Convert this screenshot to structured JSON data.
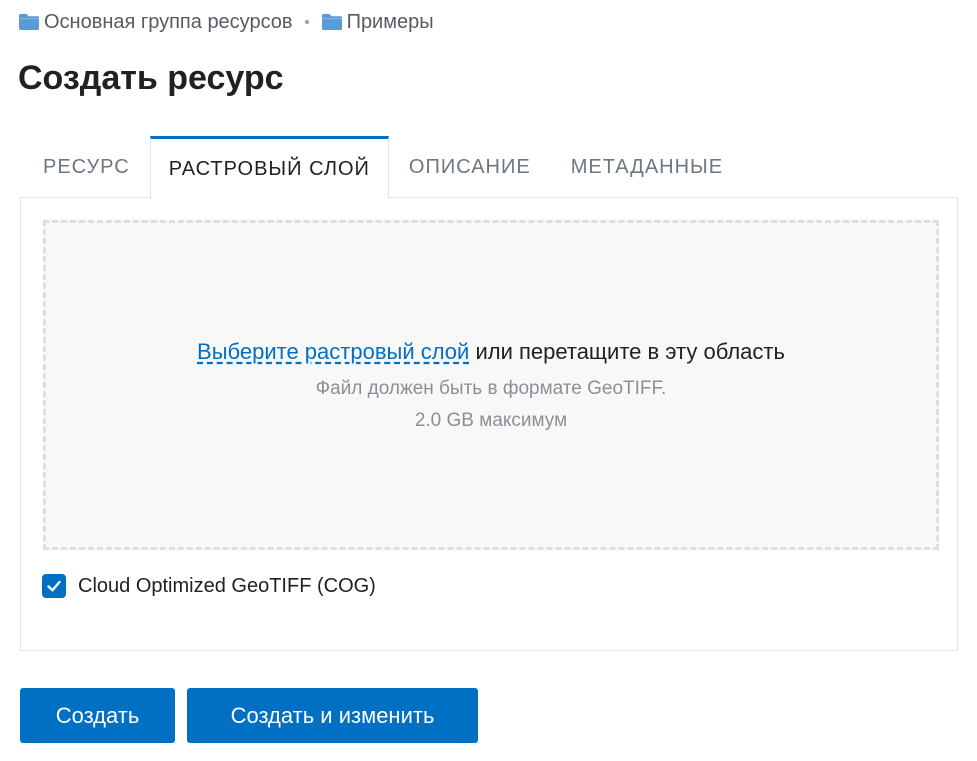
{
  "breadcrumb": {
    "items": [
      {
        "label": "Основная группа ресурсов",
        "icon": "folder-icon"
      },
      {
        "label": "Примеры",
        "icon": "folder-icon"
      }
    ]
  },
  "page": {
    "title": "Создать ресурс"
  },
  "tabs": [
    {
      "label": "РЕСУРС",
      "active": false
    },
    {
      "label": "РАСТРОВЫЙ СЛОЙ",
      "active": true
    },
    {
      "label": "ОПИСАНИЕ",
      "active": false
    },
    {
      "label": "МЕТАДАННЫЕ",
      "active": false
    }
  ],
  "dropzone": {
    "link_text": "Выберите растровый слой",
    "rest_text": " или перетащите в эту область",
    "format_hint": "Файл должен быть в формате GeoTIFF.",
    "size_hint": "2.0 GB максимум"
  },
  "cog": {
    "label": "Cloud Optimized GeoTIFF (COG)",
    "checked": true
  },
  "actions": {
    "create_label": "Создать",
    "create_edit_label": "Создать и изменить"
  },
  "colors": {
    "accent": "#0070c5",
    "folder": "#5a9bd6",
    "muted_text": "#8a9096"
  }
}
